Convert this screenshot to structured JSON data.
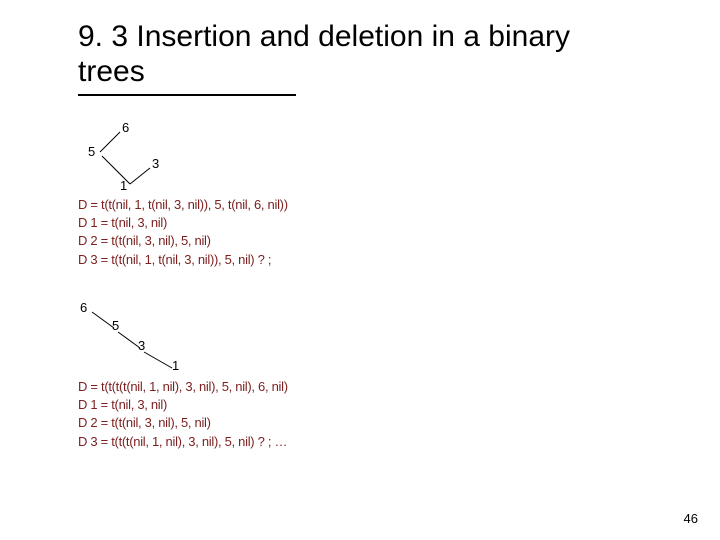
{
  "title": "9. 3 Insertion and deletion in a binary trees",
  "page_number": "46",
  "tree1": {
    "n6": "6",
    "n5": "5",
    "n3": "3",
    "n1": "1"
  },
  "tree2": {
    "n6": "6",
    "n5": "5",
    "n3": "3",
    "n1": "1"
  },
  "defs1": {
    "d": "D = t(t(nil, 1, t(nil, 3, nil)), 5, t(nil, 6, nil))",
    "d1": "D 1 = t(nil, 3, nil)",
    "d2": "D 2 = t(t(nil, 3, nil), 5, nil)",
    "d3": "D 3 = t(t(nil, 1, t(nil, 3, nil)), 5, nil) ? ;"
  },
  "defs2": {
    "d": "D = t(t(t(t(nil, 1, nil), 3, nil), 5, nil), 6, nil)",
    "d1": "D 1 = t(nil, 3, nil)",
    "d2": "D 2 = t(t(nil, 3, nil), 5, nil)",
    "d3": "D 3 = t(t(t(nil, 1, nil), 3, nil), 5, nil) ? ; …"
  }
}
